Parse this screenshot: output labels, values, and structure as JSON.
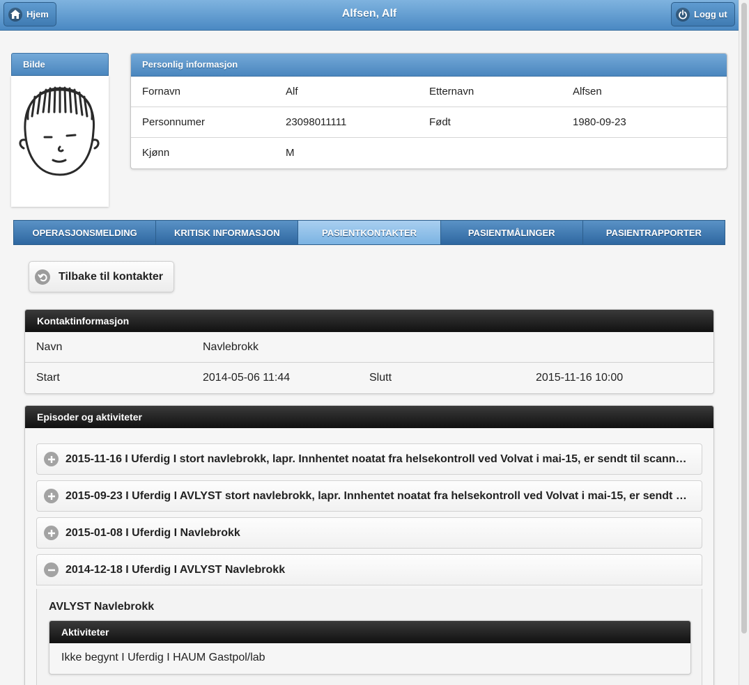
{
  "header": {
    "title": "Alfsen, Alf",
    "home_label": "Hjem",
    "logout_label": "Logg ut"
  },
  "photo": {
    "title": "Bilde"
  },
  "personal": {
    "title": "Personlig informasjon",
    "rows": [
      {
        "l1": "Fornavn",
        "v1": "Alf",
        "l2": "Etternavn",
        "v2": "Alfsen"
      },
      {
        "l1": "Personnumer",
        "v1": "23098011111",
        "l2": "Født",
        "v2": "1980-09-23"
      },
      {
        "l1": "Kjønn",
        "v1": "M",
        "l2": "",
        "v2": ""
      }
    ]
  },
  "tabs": [
    "OPERASJONSMELDING",
    "KRITISK INFORMASJON",
    "PASIENTKONTAKTER",
    "PASIENTMÅLINGER",
    "PASIENTRAPPORTER"
  ],
  "back_label": "Tilbake til kontakter",
  "contact": {
    "title": "Kontaktinformasjon",
    "name_label": "Navn",
    "name_value": "Navlebrokk",
    "start_label": "Start",
    "start_value": "2014-05-06 11:44",
    "end_label": "Slutt",
    "end_value": "2015-11-16 10:00"
  },
  "episodes": {
    "title": "Episoder og aktiviteter",
    "items": [
      "2015-11-16  I  Uferdig  I  stort navlebrokk, lapr. Innhentet noatat fra helsekontroll ved Volvat i mai-15, er sendt til scanning",
      "2015-09-23  I  Uferdig  I  AVLYST stort navlebrokk, lapr. Innhentet noatat fra helsekontroll ved Volvat i mai-15, er sendt til scanning",
      "2015-01-08  I  Uferdig  I  Navlebrokk",
      "2014-12-18  I  Uferdig  I  AVLYST Navlebrokk"
    ],
    "open_title": "AVLYST Navlebrokk",
    "activities_title": "Aktiviteter",
    "activity": "Ikke begynt  I  Uferdig  I  HAUM Gastpol/lab"
  }
}
